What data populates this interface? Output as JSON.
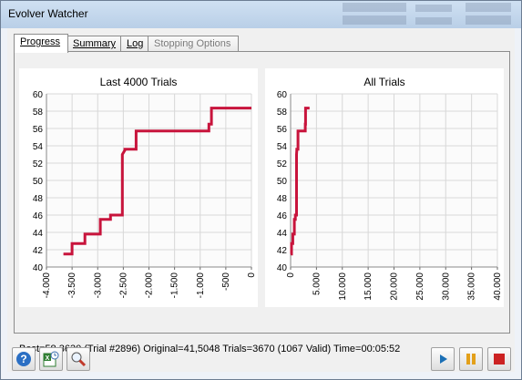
{
  "window": {
    "title": "Evolver Watcher"
  },
  "tabs": [
    {
      "label": "Progress",
      "active": true,
      "enabled": true
    },
    {
      "label": "Summary",
      "active": false,
      "enabled": true
    },
    {
      "label": "Log",
      "active": false,
      "enabled": true
    },
    {
      "label": "Stopping Options",
      "active": false,
      "enabled": false
    }
  ],
  "status_text": "Best=58,3630 (Trial #2896) Original=41,5048 Trials=3670 (1067 Valid) Time=00:05:52",
  "colors": {
    "series": "#c8143c",
    "grid": "#d8d8d8",
    "play": "#1a6fb5",
    "pause": "#e3a01a",
    "stop": "#cc2222"
  },
  "toolbar_left": [
    {
      "icon": "help-icon"
    },
    {
      "icon": "excel-report-icon"
    },
    {
      "icon": "search-zoom-icon"
    }
  ],
  "toolbar_right": [
    {
      "icon": "play-icon"
    },
    {
      "icon": "pause-icon"
    },
    {
      "icon": "stop-icon"
    }
  ],
  "chart_data": [
    {
      "type": "line",
      "title": "Last 4000 Trials",
      "xlim": [
        -4000,
        0
      ],
      "ylim": [
        40,
        60
      ],
      "x_ticks": [
        "-4.000",
        "-3.500",
        "-3.000",
        "-2.500",
        "-2.000",
        "-1.500",
        "-1.000",
        "-500",
        "0"
      ],
      "y_ticks": [
        "40",
        "42",
        "44",
        "46",
        "48",
        "50",
        "52",
        "54",
        "56",
        "58",
        "60"
      ],
      "grid": true,
      "series": [
        {
          "x": [
            -3670,
            -3500,
            -3500,
            -3250,
            -3250,
            -2950,
            -2950,
            -2750,
            -2750,
            -2520,
            -2520,
            -2470,
            -2470,
            -2250,
            -2250,
            -830,
            -830,
            -780,
            -780,
            0
          ],
          "y": [
            41.5,
            41.5,
            42.7,
            42.7,
            43.8,
            43.8,
            45.5,
            45.5,
            46.0,
            46.0,
            53.0,
            53.5,
            53.6,
            53.6,
            55.7,
            55.7,
            56.5,
            56.5,
            58.36,
            58.36
          ]
        }
      ]
    },
    {
      "type": "line",
      "title": "All Trials",
      "xlim": [
        0,
        40000
      ],
      "ylim": [
        40,
        60
      ],
      "x_ticks": [
        "0",
        "5.000",
        "10.000",
        "15.000",
        "20.000",
        "25.000",
        "30.000",
        "35.000",
        "40.000"
      ],
      "y_ticks": [
        "40",
        "42",
        "44",
        "46",
        "48",
        "50",
        "52",
        "54",
        "56",
        "58",
        "60"
      ],
      "grid": true,
      "series": [
        {
          "x": [
            0,
            170,
            170,
            420,
            420,
            720,
            720,
            920,
            920,
            1150,
            1150,
            1200,
            1200,
            1420,
            1420,
            2840,
            2840,
            2890,
            2890,
            3670
          ],
          "y": [
            41.5,
            41.5,
            42.7,
            42.7,
            43.8,
            43.8,
            45.5,
            45.5,
            46.0,
            46.0,
            53.0,
            53.5,
            53.6,
            53.6,
            55.7,
            55.7,
            56.5,
            56.5,
            58.36,
            58.36
          ]
        }
      ]
    }
  ]
}
